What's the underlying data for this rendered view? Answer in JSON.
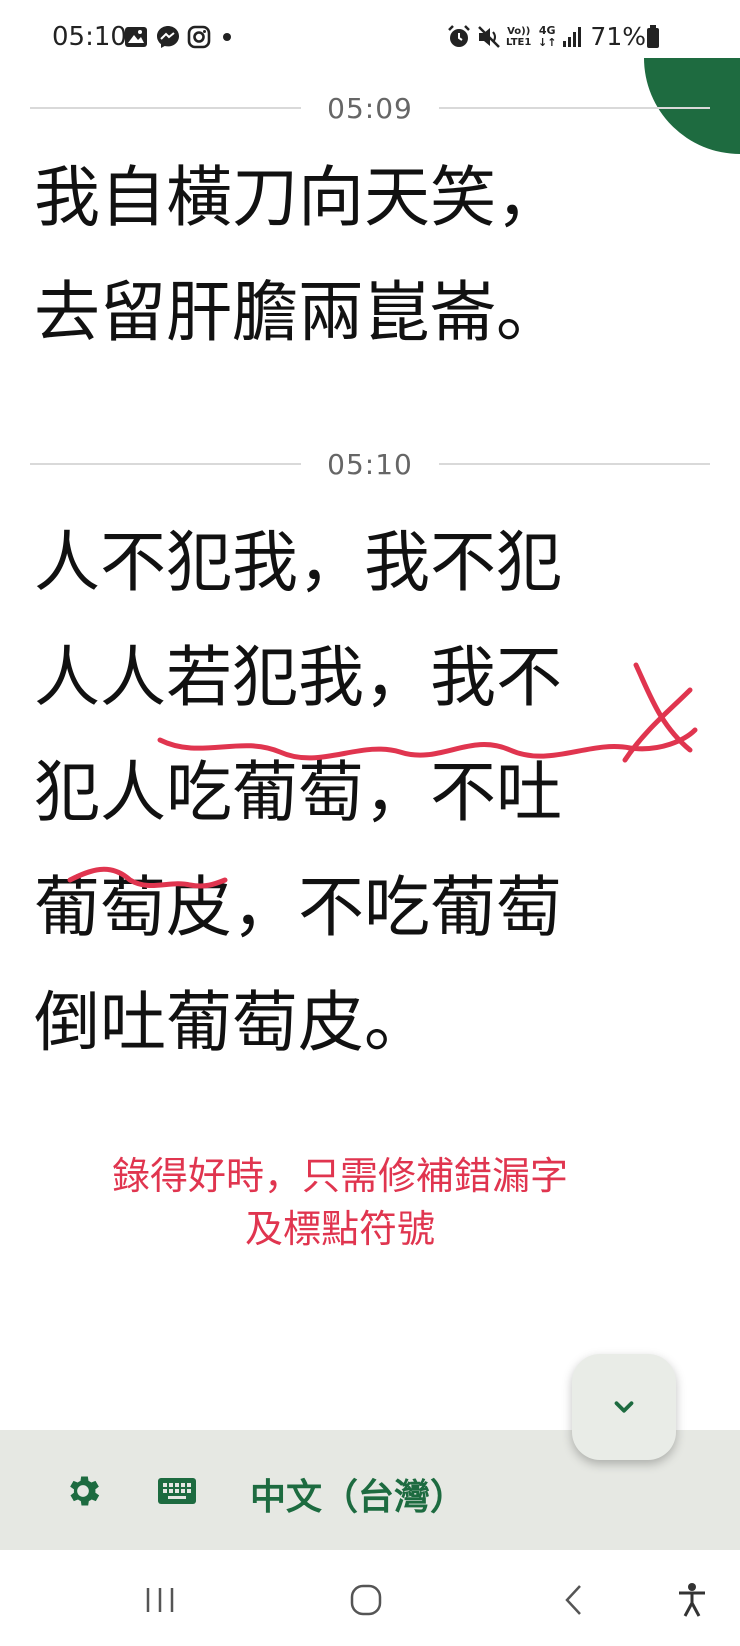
{
  "status_bar": {
    "time": "05:10",
    "battery": "71%",
    "icons": [
      "gallery-icon",
      "messenger-icon",
      "instagram-icon",
      "dot-icon",
      "alarm-icon",
      "mute-icon",
      "volte-icon",
      "4g-icon",
      "signal-icon",
      "battery-icon"
    ]
  },
  "transcript": {
    "segments": [
      {
        "timestamp": "05:09",
        "text": "我自橫刀向天笑，\n去留肝膽兩崑崙。"
      },
      {
        "timestamp": "05:10",
        "text": "人不犯我，我不犯\n人人若犯我，我不\n犯人吃葡萄，不吐\n葡萄皮，不吃葡萄\n倒吐葡萄皮。"
      }
    ]
  },
  "annotation": {
    "line1": "錄得好時，只需修補錯漏字",
    "line2": "及標點符號",
    "color": "#e0354f"
  },
  "toolbar": {
    "language": "中文（台灣）",
    "settings_icon": "gear-icon",
    "keyboard_icon": "keyboard-icon",
    "accent": "#1d6b40"
  },
  "fab": {
    "icon": "chevron-down-icon"
  },
  "system_nav": {
    "icons": [
      "recent-apps-icon",
      "home-icon",
      "back-icon",
      "accessibility-icon"
    ]
  }
}
